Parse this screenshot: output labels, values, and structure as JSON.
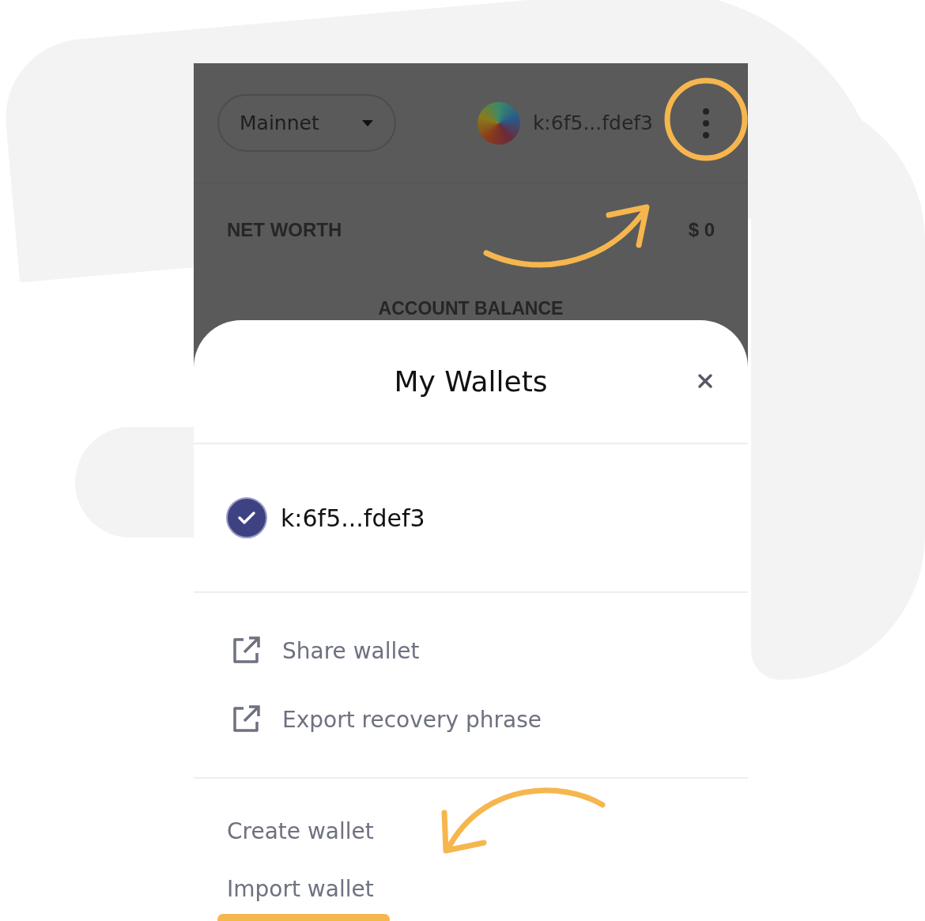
{
  "header": {
    "network": "Mainnet",
    "account": "k:6f5...fdef3",
    "net_worth_label": "NET WORTH",
    "net_worth_value": "$ 0",
    "balance_label": "ACCOUNT BALANCE"
  },
  "modal": {
    "title": "My Wallets",
    "wallets": [
      {
        "address": "k:6f5...fdef3",
        "selected": true
      }
    ],
    "actions": [
      {
        "label": "Share wallet"
      },
      {
        "label": "Export recovery phrase"
      }
    ],
    "links": [
      {
        "label": "Create wallet",
        "highlighted": false
      },
      {
        "label": "Import wallet",
        "highlighted": true
      }
    ]
  }
}
